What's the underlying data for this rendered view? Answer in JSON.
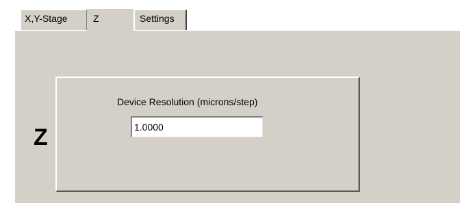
{
  "tabs": [
    {
      "label": "X,Y-Stage",
      "selected": false
    },
    {
      "label": "Z",
      "selected": true
    },
    {
      "label": "Settings",
      "selected": false
    }
  ],
  "panel": {
    "axis_label": "Z",
    "resolution": {
      "label": "Device Resolution (microns/step)",
      "value": "1.0000"
    }
  },
  "colors": {
    "panel_background": "#d4d0c8",
    "window_background": "#ffffff"
  }
}
